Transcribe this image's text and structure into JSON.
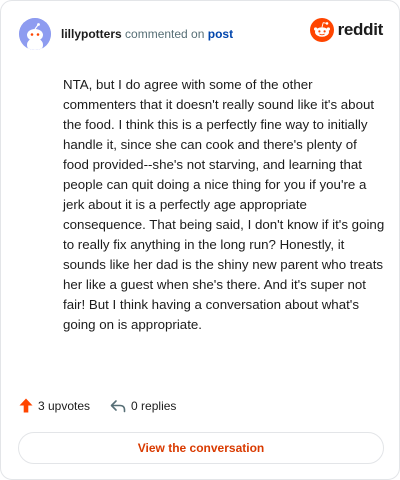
{
  "header": {
    "username": "lillypotters",
    "action_text": "commented on",
    "post_link": "post",
    "logo_text": "reddit"
  },
  "comment": {
    "text": "NTA, but I do agree with some of the other commenters that it doesn't really sound like it's about the food. I think this is a perfectly fine way to initially handle it, since she can cook and there's plenty of food provided--she's not starving, and learning that people can quit doing a nice thing for you if you're a jerk about it is a perfectly age appropriate consequence. That being said, I don't know if it's going to really fix anything in the long run? Honestly, it sounds like her dad is the shiny new parent who treats her like a guest when she's there. And it's super not fair! But I think having a conversation about what's going on is appropriate."
  },
  "actions": {
    "upvotes": "3 upvotes",
    "replies": "0 replies"
  },
  "cta": {
    "label": "View the conversation"
  },
  "colors": {
    "accent": "#d93a00",
    "upvote": "#ff4500",
    "link": "#0045ac",
    "avatar_bg": "#8e9cf0"
  },
  "icons": {
    "avatar": "snoo-avatar-icon",
    "logo": "reddit-logo-icon",
    "upvote": "upvote-arrow-icon",
    "reply": "reply-arrow-icon"
  }
}
